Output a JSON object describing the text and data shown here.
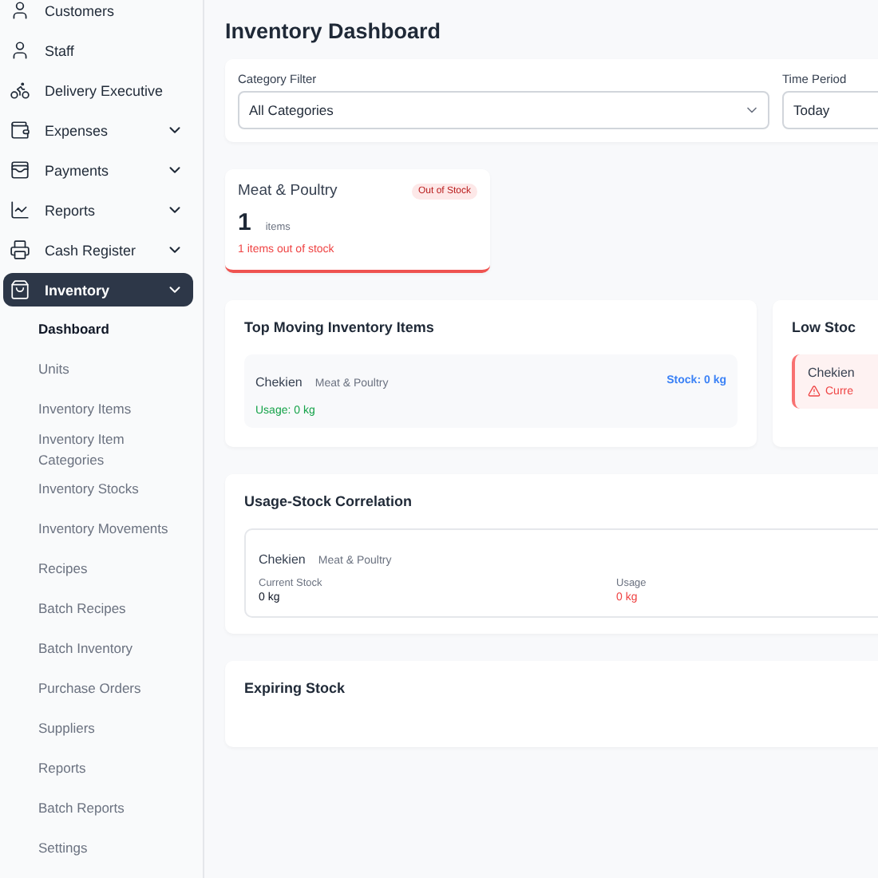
{
  "sidebar": {
    "items": [
      {
        "label": "Customers",
        "kind": "link",
        "selected": false
      },
      {
        "label": "Staff",
        "kind": "link",
        "selected": false
      },
      {
        "label": "Delivery Executive",
        "kind": "link",
        "selected": false
      },
      {
        "label": "Expenses",
        "kind": "group",
        "selected": false
      },
      {
        "label": "Payments",
        "kind": "group",
        "selected": false
      },
      {
        "label": "Reports",
        "kind": "group",
        "selected": false
      },
      {
        "label": "Cash Register",
        "kind": "group",
        "selected": false
      },
      {
        "label": "Inventory",
        "kind": "group",
        "selected": true,
        "children": [
          {
            "label": "Dashboard",
            "selected": true
          },
          {
            "label": "Units",
            "selected": false
          },
          {
            "label": "Inventory Items",
            "selected": false
          },
          {
            "label": "Inventory Item Categories",
            "selected": false
          },
          {
            "label": "Inventory Stocks",
            "selected": false
          },
          {
            "label": "Inventory Movements",
            "selected": false
          },
          {
            "label": "Recipes",
            "selected": false
          },
          {
            "label": "Batch Recipes",
            "selected": false
          },
          {
            "label": "Batch Inventory",
            "selected": false
          },
          {
            "label": "Purchase Orders",
            "selected": false
          },
          {
            "label": "Suppliers",
            "selected": false
          },
          {
            "label": "Reports",
            "selected": false
          },
          {
            "label": "Batch Reports",
            "selected": false
          },
          {
            "label": "Settings",
            "selected": false
          }
        ]
      }
    ]
  },
  "page_title": "Inventory Dashboard",
  "filters": [
    {
      "label": "Category Filter",
      "value": "All Categories"
    },
    {
      "label": "Time Period",
      "value": "Today"
    }
  ],
  "category_cards": [
    {
      "name": "Meat & Poultry",
      "badge": "Out of Stock",
      "count": "1",
      "unit": "items",
      "note": "1 items out of stock"
    }
  ],
  "top_moving": {
    "title": "Top Moving Inventory Items",
    "items": [
      {
        "name": "Chekien",
        "category": "Meat & Poultry",
        "stock": "Stock: 0 kg",
        "usage": "Usage: 0 kg"
      }
    ]
  },
  "low_stock": {
    "title": "Low Stoc",
    "items": [
      {
        "name": "Chekien",
        "warning": "Curre"
      }
    ]
  },
  "correlation": {
    "title": "Usage-Stock Correlation",
    "items": [
      {
        "name": "Chekien",
        "category": "Meat & Poultry",
        "stats": [
          {
            "label": "Current Stock",
            "value": "0 kg",
            "kind": "stock"
          },
          {
            "label": "Usage",
            "value": "0 kg",
            "kind": "usage"
          }
        ]
      }
    ]
  },
  "expiring": {
    "title": "Expiring Stock"
  }
}
